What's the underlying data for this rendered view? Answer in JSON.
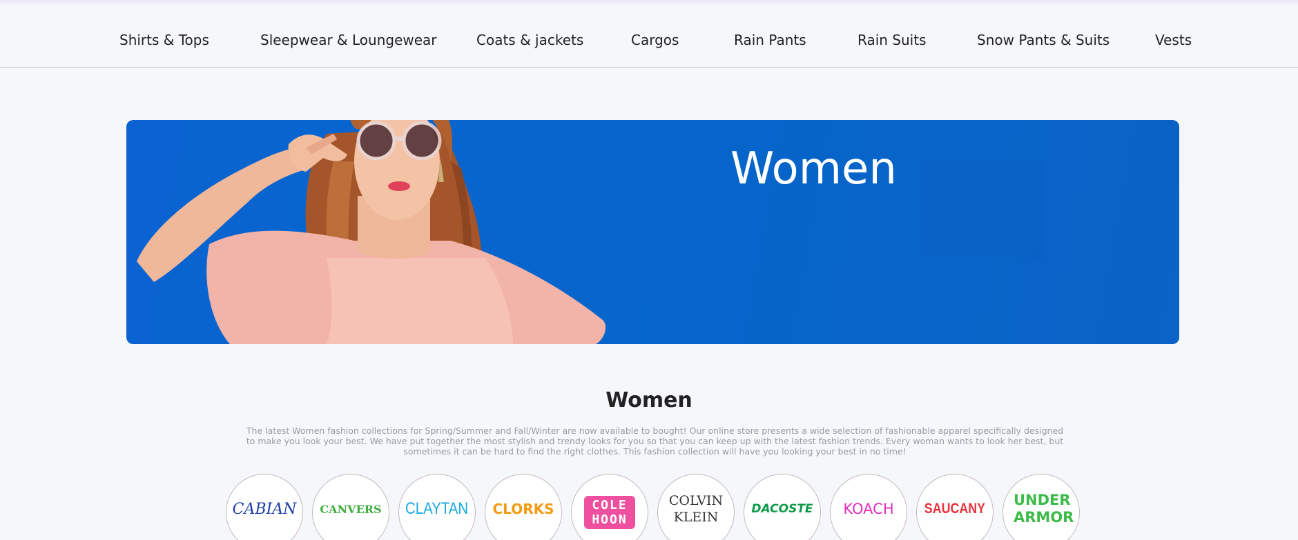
{
  "nav": {
    "items": [
      "Shirts & Tops",
      "Sleepwear & Loungewear",
      "Coats & jackets",
      "Cargos",
      "Rain Pants",
      "Rain Suits",
      "Snow Pants & Suits",
      "Vests"
    ]
  },
  "banner": {
    "title": "Women"
  },
  "section": {
    "title": "Women",
    "description": "The latest Women fashion collections for Spring/Summer and Fall/Winter are now available to bought! Our online store presents a wide selection of fashionable apparel specifically designed to make you look your best. We have put together the most stylish and trendy looks for you so that you can keep up with the latest fashion trends. Every woman wants to look her best, but sometimes it can be hard to find the right clothes. This fashion collection will have you looking your best in no time!"
  },
  "brands": [
    {
      "name": "CABIAN",
      "color": "#1d3fa6"
    },
    {
      "name": "CANVERS",
      "color": "#3fae3f"
    },
    {
      "name": "CLAYTAN",
      "color": "#17a9e0"
    },
    {
      "name": "CLORKS",
      "color": "#f29b12"
    },
    {
      "name": "COLE HOON",
      "color": "#ee4f9e"
    },
    {
      "name": "COLVIN KLEIN",
      "color": "#333333"
    },
    {
      "name": "DACOSTE",
      "color": "#0e9a4a"
    },
    {
      "name": "KOACH",
      "color": "#e02fb8"
    },
    {
      "name": "SAUCANY",
      "color": "#e8323c"
    },
    {
      "name": "UNDER ARMOR",
      "color": "#3dbb49"
    }
  ]
}
